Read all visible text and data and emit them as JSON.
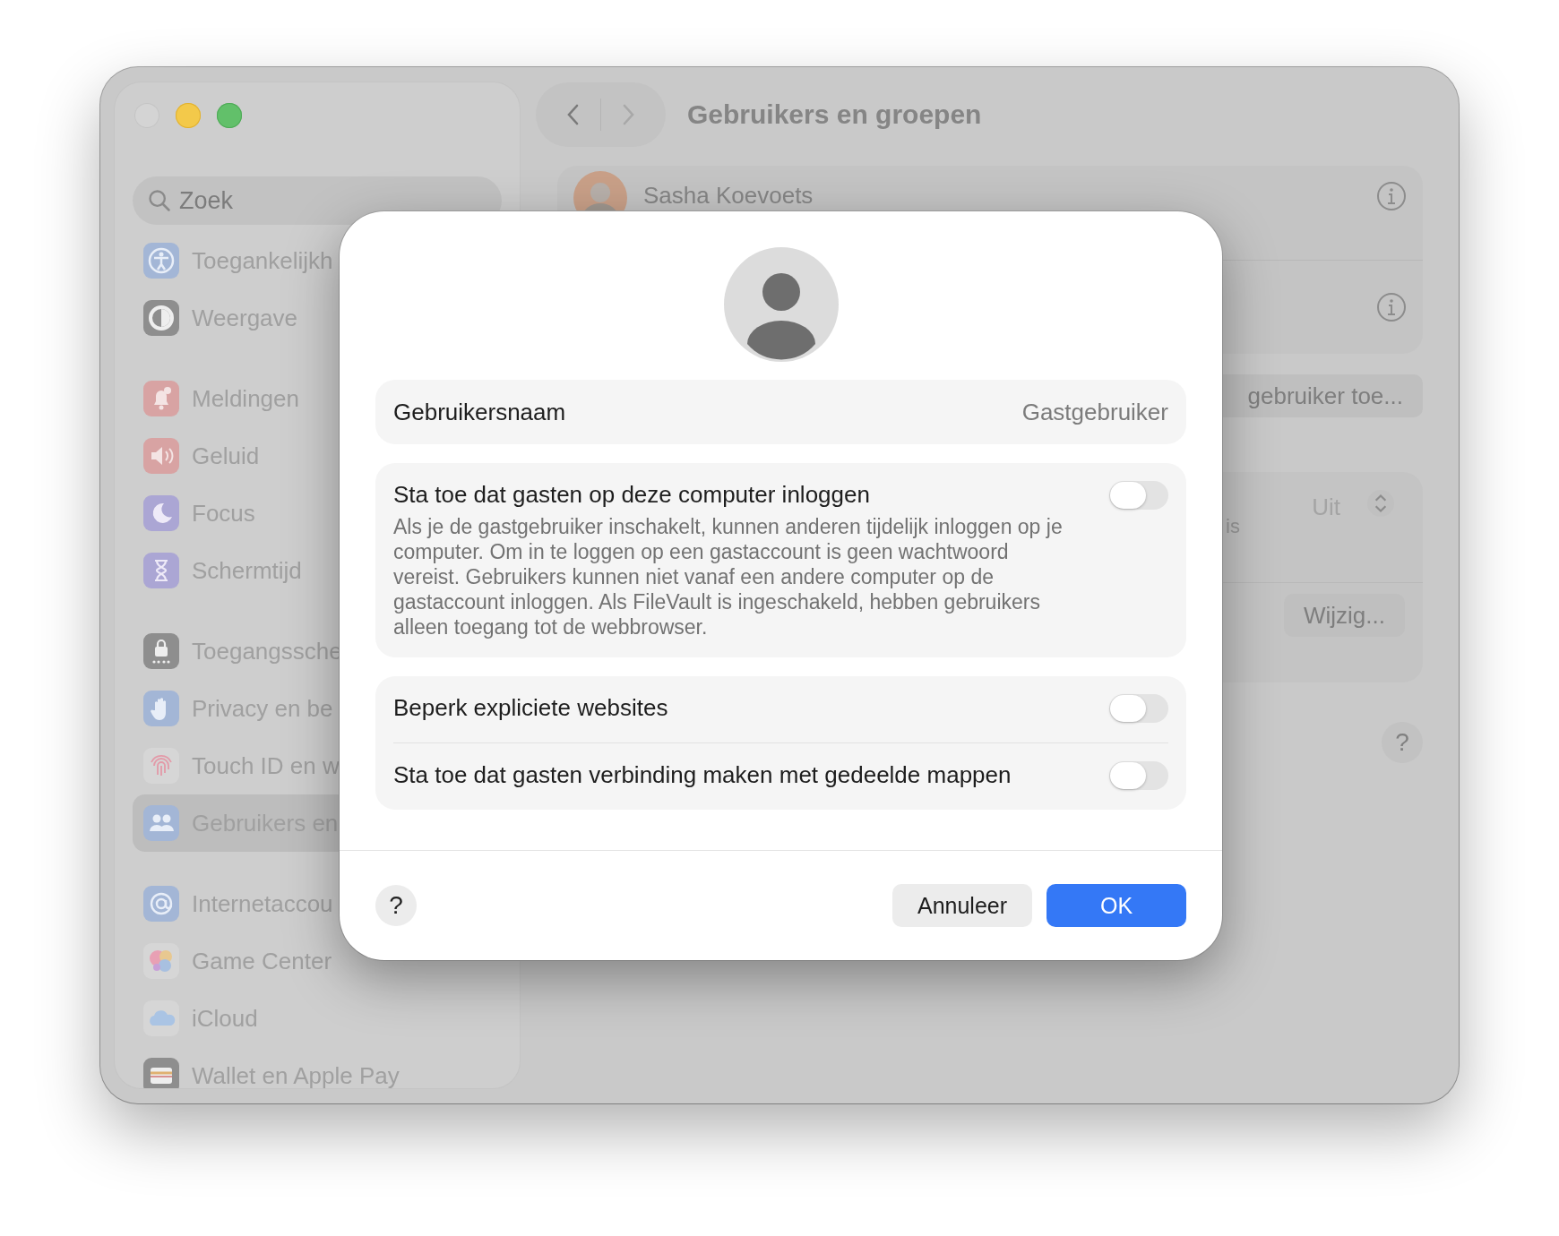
{
  "window": {
    "title": "Gebruikers en groepen"
  },
  "sidebar": {
    "search": {
      "value": "Zoek"
    },
    "groups": [
      [
        {
          "label": "Toegankelijkh",
          "selected": false
        },
        {
          "label": "Weergave",
          "selected": false
        }
      ],
      [
        {
          "label": "Meldingen",
          "selected": false
        },
        {
          "label": "Geluid",
          "selected": false
        },
        {
          "label": "Focus",
          "selected": false
        },
        {
          "label": "Schermtijd",
          "selected": false
        }
      ],
      [
        {
          "label": "Toegangssche",
          "selected": false
        },
        {
          "label": "Privacy en be",
          "selected": false
        },
        {
          "label": "Touch ID en w",
          "selected": false
        },
        {
          "label": "Gebruikers en",
          "selected": true
        }
      ],
      [
        {
          "label": "Internetaccou",
          "selected": false
        },
        {
          "label": "Game Center",
          "selected": false
        },
        {
          "label": "iCloud",
          "selected": false
        },
        {
          "label": "Wallet en Apple Pay",
          "selected": false
        }
      ]
    ]
  },
  "content": {
    "users": [
      {
        "name": "Sasha Koevoets"
      }
    ],
    "add_user_button": "gebruiker toe...",
    "guest": {
      "value": "Uit",
      "note": "is",
      "change_button": "Wijzig..."
    },
    "help": "?"
  },
  "dialog": {
    "username": {
      "label": "Gebruikersnaam",
      "value": "Gastgebruiker"
    },
    "sections": [
      [
        {
          "label": "Sta toe dat gasten op deze computer inloggen",
          "description": "Als je de gastgebruiker inschakelt, kunnen anderen tijdelijk inloggen op je computer. Om in te loggen op een gastaccount is geen wachtwoord vereist. Gebruikers kunnen niet vanaf een andere computer op de gastaccount inloggen. Als FileVault is ingeschakeld, hebben gebruikers alleen toegang tot de webbrowser.",
          "on": false
        }
      ],
      [
        {
          "label": "Beperk expliciete websites",
          "on": false
        },
        {
          "label": "Sta toe dat gasten verbinding maken met gedeelde mappen",
          "on": false
        }
      ]
    ],
    "help": "?",
    "cancel": "Annuleer",
    "ok": "OK"
  }
}
